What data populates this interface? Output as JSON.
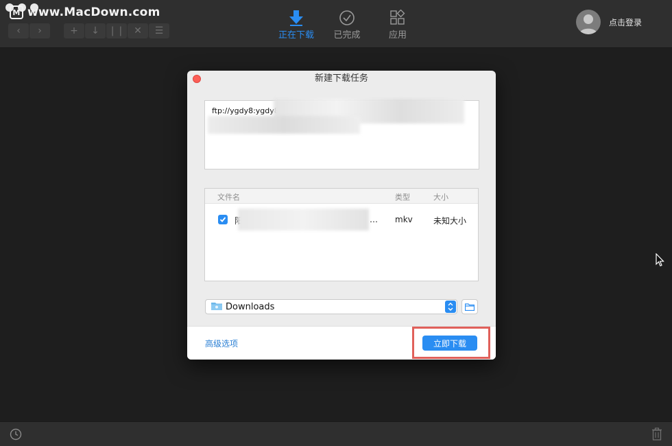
{
  "watermark": {
    "text": "www.MacDown.com"
  },
  "tabs": [
    {
      "label": "正在下载",
      "icon": "download-arrow-icon",
      "active": true
    },
    {
      "label": "已完成",
      "icon": "check-circle-icon",
      "active": false
    },
    {
      "label": "应用",
      "icon": "apps-grid-icon",
      "active": false
    }
  ],
  "user": {
    "login_label": "点击登录"
  },
  "dialog": {
    "title": "新建下载任务",
    "url_text": "ftp://ygdy8:ygdy8",
    "file_list": {
      "columns": {
        "name": "文件名",
        "type": "类型",
        "size": "大小"
      },
      "rows": [
        {
          "name_prefix": "阳",
          "ellipsis": "…",
          "type": "mkv",
          "size": "未知大小",
          "checked": true
        }
      ]
    },
    "save_path": "Downloads",
    "advanced_link": "高级选项",
    "start_button": "立即下载"
  },
  "colors": {
    "accent": "#2a8df2",
    "highlight": "#e0605a",
    "close": "#fc5f57"
  }
}
